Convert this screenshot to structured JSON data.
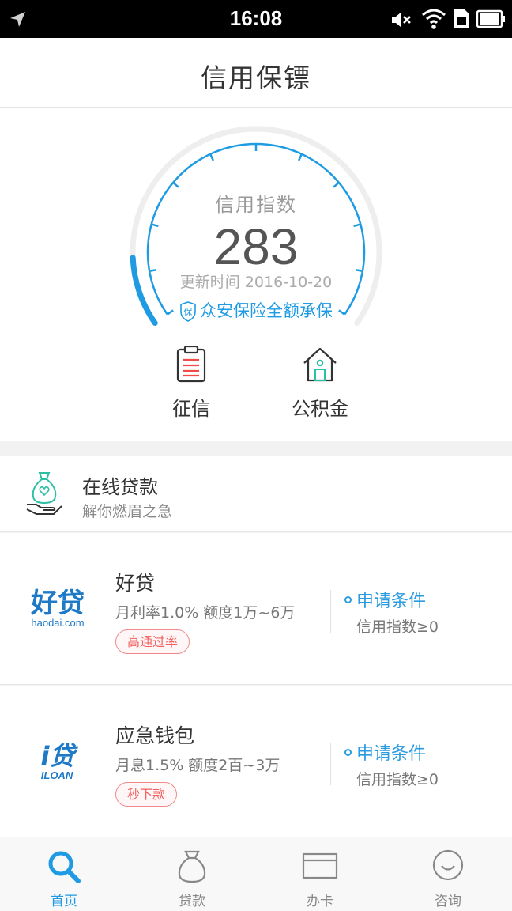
{
  "status_bar": {
    "time": "16:08"
  },
  "header": {
    "title": "信用保镖"
  },
  "credit": {
    "label": "信用指数",
    "score": 283,
    "update": "更新时间 2016-10-20",
    "insurance": "众安保险全额承保",
    "shield_glyph": "保",
    "gauge_fill_fraction": 0.13,
    "accent_color": "#1e9be3"
  },
  "quick_actions": [
    {
      "label": "征信",
      "icon": "clipboard-icon"
    },
    {
      "label": "公积金",
      "icon": "house-icon"
    }
  ],
  "online_loans": {
    "title": "在线贷款",
    "subtitle": "解你燃眉之急",
    "icon": "money-bag-hand-icon"
  },
  "loans": [
    {
      "name": "好贷",
      "desc": "月利率1.0% 额度1万~6万",
      "tag": "高通过率",
      "cond_title": "申请条件",
      "cond_req": "信用指数≥0",
      "logo_text": "好贷",
      "logo_sub": "haodai.com"
    },
    {
      "name": "应急钱包",
      "desc": "月息1.5% 额度2百~3万",
      "tag": "秒下款",
      "cond_title": "申请条件",
      "cond_req": "信用指数≥0",
      "logo_text": "i贷",
      "logo_sub": "ILOAN"
    }
  ],
  "tabs": [
    {
      "label": "首页",
      "icon": "search-icon",
      "active": true
    },
    {
      "label": "贷款",
      "icon": "money-bag-icon",
      "active": false
    },
    {
      "label": "办卡",
      "icon": "card-icon",
      "active": false
    },
    {
      "label": "咨询",
      "icon": "smiley-icon",
      "active": false
    }
  ]
}
